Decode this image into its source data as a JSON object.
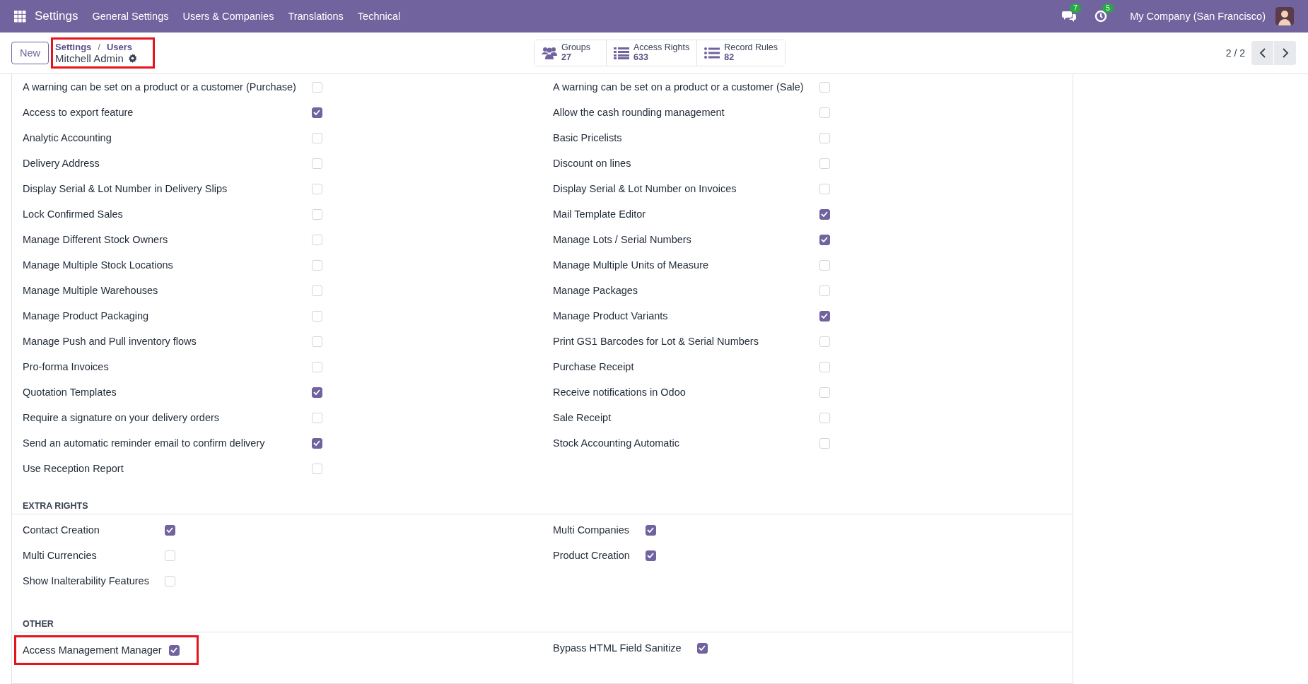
{
  "navbar": {
    "app_name": "Settings",
    "menus": [
      "General Settings",
      "Users & Companies",
      "Translations",
      "Technical"
    ],
    "messages_count": "7",
    "activities_count": "5",
    "company": "My Company (San Francisco)"
  },
  "control_panel": {
    "new_button": "New",
    "breadcrumb": [
      "Settings",
      "Users"
    ],
    "breadcrumb_separator": "/",
    "record_name": "Mitchell Admin",
    "highlighted": true,
    "smart_buttons": [
      {
        "kind": "groups",
        "label": "Groups",
        "value": "27"
      },
      {
        "kind": "rights",
        "label": "Access Rights",
        "value": "633"
      },
      {
        "kind": "rules",
        "label": "Record Rules",
        "value": "82"
      }
    ],
    "pager": "2 / 2"
  },
  "sections": [
    {
      "left": [
        {
          "label": "A warning can be set on a product or a customer (Purchase)",
          "checked": false,
          "highlighted": false
        },
        {
          "label": "Access to export feature",
          "checked": true,
          "highlighted": false
        },
        {
          "label": "Analytic Accounting",
          "checked": false,
          "highlighted": false
        },
        {
          "label": "Delivery Address",
          "checked": false,
          "highlighted": false
        },
        {
          "label": "Display Serial & Lot Number in Delivery Slips",
          "checked": false,
          "highlighted": false
        },
        {
          "label": "Lock Confirmed Sales",
          "checked": false,
          "highlighted": false
        },
        {
          "label": "Manage Different Stock Owners",
          "checked": false,
          "highlighted": false
        },
        {
          "label": "Manage Multiple Stock Locations",
          "checked": false,
          "highlighted": false
        },
        {
          "label": "Manage Multiple Warehouses",
          "checked": false,
          "highlighted": false
        },
        {
          "label": "Manage Product Packaging",
          "checked": false,
          "highlighted": false
        },
        {
          "label": "Manage Push and Pull inventory flows",
          "checked": false,
          "highlighted": false
        },
        {
          "label": "Pro-forma Invoices",
          "checked": false,
          "highlighted": false
        },
        {
          "label": "Quotation Templates",
          "checked": true,
          "highlighted": false
        },
        {
          "label": "Require a signature on your delivery orders",
          "checked": false,
          "highlighted": false
        },
        {
          "label": "Send an automatic reminder email to confirm delivery",
          "checked": true,
          "highlighted": false
        },
        {
          "label": "Use Reception Report",
          "checked": false,
          "highlighted": false
        }
      ],
      "right": [
        {
          "label": "A warning can be set on a product or a customer (Sale)",
          "checked": false,
          "highlighted": false
        },
        {
          "label": "Allow the cash rounding management",
          "checked": false,
          "highlighted": false
        },
        {
          "label": "Basic Pricelists",
          "checked": false,
          "highlighted": false
        },
        {
          "label": "Discount on lines",
          "checked": false,
          "highlighted": false
        },
        {
          "label": "Display Serial & Lot Number on Invoices",
          "checked": false,
          "highlighted": false
        },
        {
          "label": "Mail Template Editor",
          "checked": true,
          "highlighted": false
        },
        {
          "label": "Manage Lots / Serial Numbers",
          "checked": true,
          "highlighted": false
        },
        {
          "label": "Manage Multiple Units of Measure",
          "checked": false,
          "highlighted": false
        },
        {
          "label": "Manage Packages",
          "checked": false,
          "highlighted": false
        },
        {
          "label": "Manage Product Variants",
          "checked": true,
          "highlighted": false
        },
        {
          "label": "Print GS1 Barcodes for Lot & Serial Numbers",
          "checked": false,
          "highlighted": false
        },
        {
          "label": "Purchase Receipt",
          "checked": false,
          "highlighted": false
        },
        {
          "label": "Receive notifications in Odoo",
          "checked": false,
          "highlighted": false
        },
        {
          "label": "Sale Receipt",
          "checked": false,
          "highlighted": false
        },
        {
          "label": "Stock Accounting Automatic",
          "checked": false,
          "highlighted": false
        }
      ]
    },
    {
      "title": "EXTRA RIGHTS",
      "left": [
        {
          "label": "Contact Creation",
          "checked": true,
          "highlighted": false
        },
        {
          "label": "Multi Currencies",
          "checked": false,
          "highlighted": false
        },
        {
          "label": "Show Inalterability Features",
          "checked": false,
          "highlighted": false
        }
      ],
      "right": [
        {
          "label": "Multi Companies",
          "checked": true,
          "highlighted": false
        },
        {
          "label": "Product Creation",
          "checked": true,
          "highlighted": false
        }
      ]
    },
    {
      "title": "OTHER",
      "left": [
        {
          "label": "Access Management Manager",
          "checked": true,
          "highlighted": true
        }
      ],
      "right": [
        {
          "label": "Bypass HTML Field Sanitize",
          "checked": true,
          "highlighted": false
        }
      ]
    }
  ]
}
